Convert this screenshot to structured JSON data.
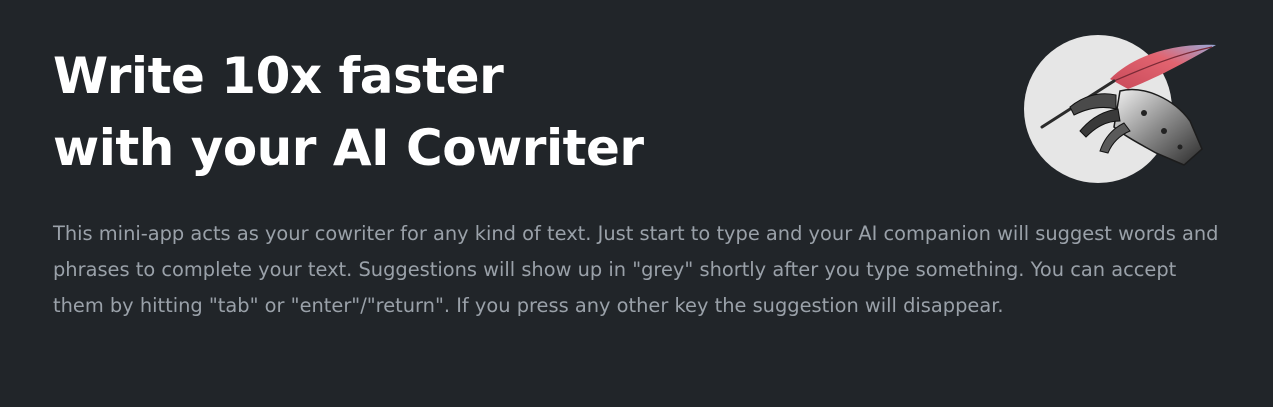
{
  "hero": {
    "headline_line1": "Write 10x faster",
    "headline_line2": "with your AI Cowriter",
    "description": "This mini-app acts as your cowriter for any kind of text. Just start to type and your AI companion will suggest words and phrases to complete your text. Suggestions will show up in \"grey\" shortly after you type something. You can accept them by hitting \"tab\" or \"enter\"/\"return\". If you press any other key the suggestion will disappear.",
    "illustration_icon": "robot-hand-quill-icon"
  },
  "colors": {
    "background": "#212529",
    "headline": "#ffffff",
    "description": "#9aa1a9",
    "illustration_circle": "#e6e6e6",
    "quill_feather": "#e05a66"
  }
}
